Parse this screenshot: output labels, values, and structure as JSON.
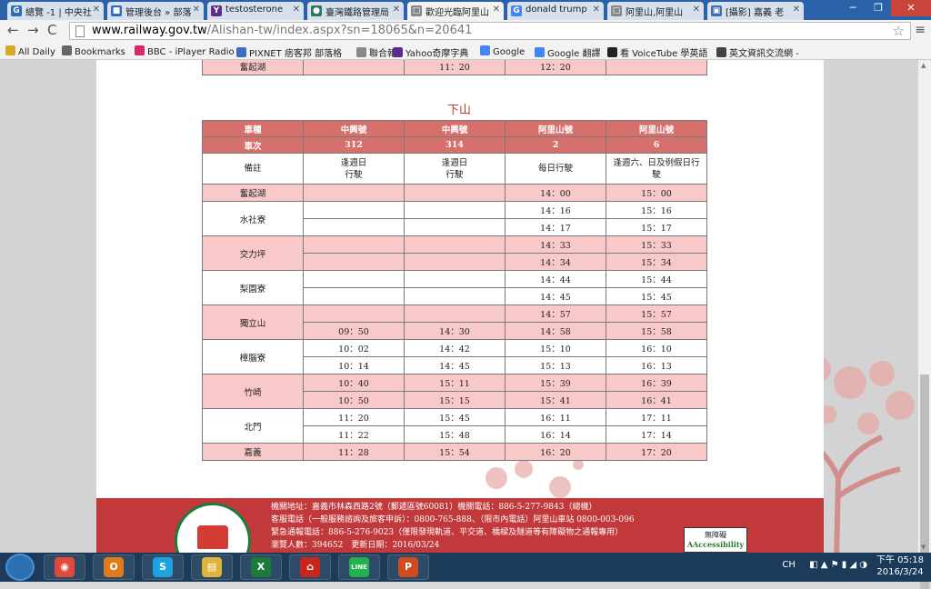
{
  "browser": {
    "tabs": [
      {
        "title": "總覽 -1 | 中央社",
        "icon_color": "#2c6cb8",
        "icon": "G"
      },
      {
        "title": "管理後台 » 部落",
        "icon_color": "#2f6bc4",
        "icon": "■"
      },
      {
        "title": "testosterone",
        "icon_color": "#5a2d8a",
        "icon": "Y"
      },
      {
        "title": "臺灣鐵路管理局",
        "icon_color": "#2a7a5a",
        "icon": "●"
      },
      {
        "title": "歡迎光臨阿里山",
        "icon_color": "#888888",
        "icon": "▢"
      },
      {
        "title": "donald trump",
        "icon_color": "#4285f4",
        "icon": "G"
      },
      {
        "title": "阿里山,阿里山",
        "icon_color": "#888888",
        "icon": "▢"
      },
      {
        "title": "[攝影] 嘉義 老",
        "icon_color": "#3d6fb0",
        "icon": "▣"
      }
    ],
    "url_host": "www.railway.gov.tw",
    "url_rest": "/Alishan-tw/index.aspx?sn=18065&n=20641",
    "bookmarks": [
      {
        "label": "All Daily",
        "color": "#d9a62b"
      },
      {
        "label": "Bookmarks",
        "color": "#666666"
      },
      {
        "label": "BBC - iPlayer Radio",
        "color": "#d6286b"
      },
      {
        "label": "PIXNET 痞客邦 部落格",
        "color": "#3a6ec4"
      },
      {
        "label": "聯合報",
        "color": "#888888"
      },
      {
        "label": "Yahoo奇摩字典",
        "color": "#5a2d8a"
      },
      {
        "label": "Google",
        "color": "#4285f4"
      },
      {
        "label": "Google 翻譯",
        "color": "#4285f4"
      },
      {
        "label": "看 VoiceTube 學英語",
        "color": "#222222"
      },
      {
        "label": "英文資訊交流網 -",
        "color": "#444444"
      }
    ]
  },
  "page": {
    "top_table_row": {
      "station": "奮起湖",
      "c1": "",
      "c2": "11：20",
      "c3": "12：20",
      "c4": ""
    },
    "section_title": "下山",
    "header": {
      "col0": "車種",
      "cols": [
        "中興號",
        "中興號",
        "阿里山號",
        "阿里山號"
      ]
    },
    "train_numbers": {
      "label": "車次",
      "values": [
        "312",
        "314",
        "2",
        "6"
      ]
    },
    "notes": {
      "label": "備註",
      "values": [
        "逢週日\n行駛",
        "逢週日\n行駛",
        "每日行駛",
        "逢週六、日及例假日行\n駛"
      ]
    },
    "stations": [
      {
        "name": "奮起湖",
        "shade": "pink",
        "rows": [
          [
            "",
            "",
            "14：00",
            "15：00"
          ]
        ]
      },
      {
        "name": "水社寮",
        "shade": "white",
        "rows": [
          [
            "",
            "",
            "14：16",
            "15：16"
          ],
          [
            "",
            "",
            "14：17",
            "15：17"
          ]
        ]
      },
      {
        "name": "交力坪",
        "shade": "pink",
        "rows": [
          [
            "",
            "",
            "14：33",
            "15：33"
          ],
          [
            "",
            "",
            "14：34",
            "15：34"
          ]
        ]
      },
      {
        "name": "梨園寮",
        "shade": "white",
        "rows": [
          [
            "",
            "",
            "14：44",
            "15：44"
          ],
          [
            "",
            "",
            "14：45",
            "15：45"
          ]
        ]
      },
      {
        "name": "獨立山",
        "shade": "pink",
        "rows": [
          [
            "",
            "",
            "14：57",
            "15：57"
          ],
          [
            "09：50",
            "14：30",
            "14：58",
            "15：58"
          ]
        ]
      },
      {
        "name": "樟腦寮",
        "shade": "white",
        "rows": [
          [
            "10：02",
            "14：42",
            "15：10",
            "16：10"
          ],
          [
            "10：14",
            "14：45",
            "15：13",
            "16：13"
          ]
        ]
      },
      {
        "name": "竹崎",
        "shade": "pink",
        "rows": [
          [
            "10：40",
            "15：11",
            "15：39",
            "16：39"
          ],
          [
            "10：50",
            "15：15",
            "15：41",
            "16：41"
          ]
        ]
      },
      {
        "name": "北門",
        "shade": "white",
        "rows": [
          [
            "11：20",
            "15：45",
            "16：11",
            "17：11"
          ],
          [
            "11：22",
            "15：48",
            "16：14",
            "17：14"
          ]
        ]
      },
      {
        "name": "嘉義",
        "shade": "pink",
        "rows": [
          [
            "11：28",
            "15：54",
            "16：20",
            "17：20"
          ]
        ]
      }
    ],
    "footer": {
      "lines": [
        "機關地址：嘉義市林森西路2號（郵遞區號60081）機關電話：886-5-277-9843（總機）",
        "客服電話（一般服務諮詢及旅客申訴）：0800-765-888、（限市內電話）阿里山車站 0800-003-096",
        "緊急通報電話：886-5-276-9023（僅限發現軌道、平交道、橋樑及隧道等有障礙物之通報專用）",
        "瀏覽人數：394652　更新日期：2016/03/24"
      ],
      "accessibility_label": "無障礙",
      "accessibility_sub": "AAccessibility"
    }
  },
  "taskbar": {
    "apps": [
      {
        "name": "chrome",
        "color": "#e04a3a",
        "glyph": "◉"
      },
      {
        "name": "outlook",
        "color": "#e07a1a",
        "glyph": "O"
      },
      {
        "name": "skype",
        "color": "#1fa3e0",
        "glyph": "S"
      },
      {
        "name": "explorer",
        "color": "#e0b43a",
        "glyph": "▤"
      },
      {
        "name": "excel",
        "color": "#1d7a3f",
        "glyph": "X"
      },
      {
        "name": "acrobat",
        "color": "#c8251f",
        "glyph": "⌂"
      },
      {
        "name": "line",
        "color": "#22b24c",
        "glyph": "LINE"
      },
      {
        "name": "powerpoint",
        "color": "#d04a1f",
        "glyph": "P"
      }
    ],
    "lang": "CH",
    "time": "下午 05:18",
    "date": "2016/3/24"
  }
}
